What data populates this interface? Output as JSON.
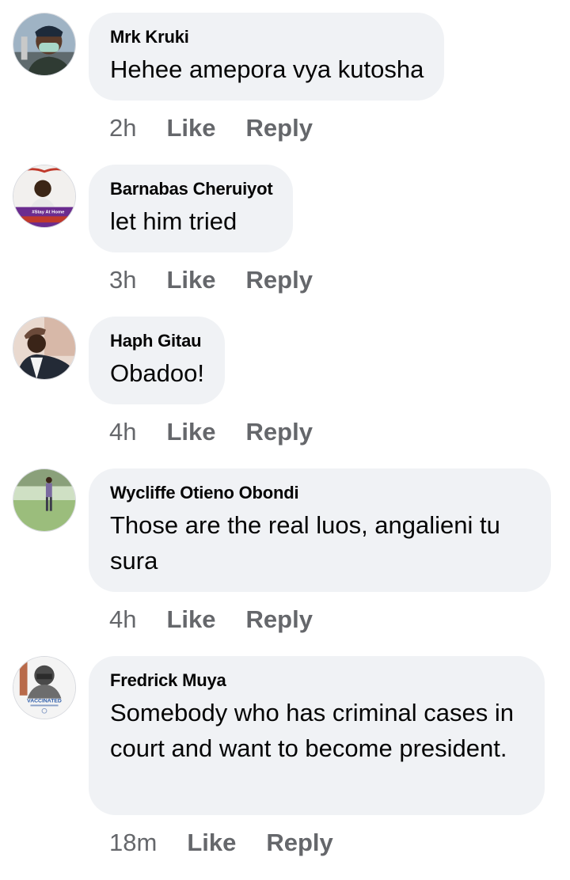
{
  "comments": [
    {
      "author": "Mrk Kruki",
      "text": "Hehee amepora vya kutosha",
      "time": "2h",
      "like": "Like",
      "reply": "Reply"
    },
    {
      "author": "Barnabas Cheruiyot",
      "text": "let him tried",
      "time": "3h",
      "like": "Like",
      "reply": "Reply",
      "avatar_caption": "#Stay At Home"
    },
    {
      "author": "Haph Gitau",
      "text": "Obadoo!",
      "time": "4h",
      "like": "Like",
      "reply": "Reply"
    },
    {
      "author": "Wycliffe Otieno Obondi",
      "text": "Those are the real luos, angalieni tu sura",
      "time": "4h",
      "like": "Like",
      "reply": "Reply"
    },
    {
      "author": "Fredrick Muya",
      "text": "Somebody who has criminal cases in court and want to become president.",
      "time": "18m",
      "like": "Like",
      "reply": "Reply",
      "avatar_caption": "VACCINATED"
    }
  ],
  "colors": {
    "bubble": "#f0f2f5",
    "author": "#050505",
    "meta": "#65676b"
  }
}
